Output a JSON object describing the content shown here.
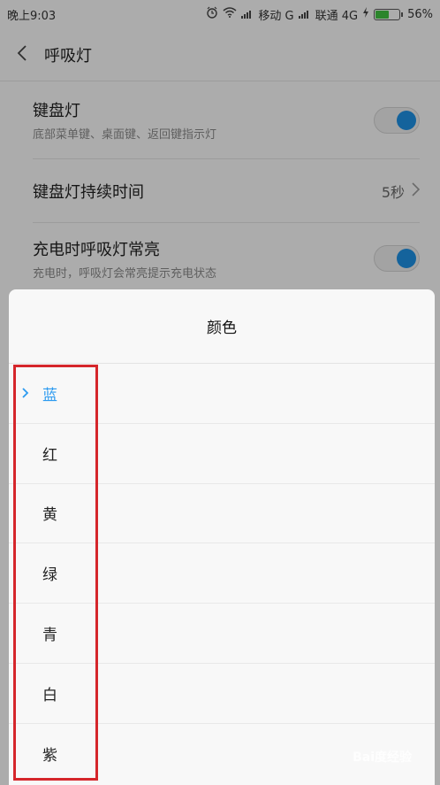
{
  "status_bar": {
    "time": "晚上9:03",
    "carrier1": "移动 G",
    "carrier2": "联通 4G",
    "battery": "56%",
    "battery_level": 0.56
  },
  "header": {
    "title": "呼吸灯"
  },
  "settings": [
    {
      "title": "键盘灯",
      "subtitle": "底部菜单键、桌面键、返回键指示灯",
      "type": "toggle",
      "on": true
    },
    {
      "title": "键盘灯持续时间",
      "value": "5秒",
      "type": "link"
    },
    {
      "title": "充电时呼吸灯常亮",
      "subtitle": "充电时，呼吸灯会常亮提示充电状态",
      "type": "toggle",
      "on": true
    }
  ],
  "sheet": {
    "title": "颜色",
    "options": [
      {
        "label": "蓝",
        "selected": true
      },
      {
        "label": "红",
        "selected": false
      },
      {
        "label": "黄",
        "selected": false
      },
      {
        "label": "绿",
        "selected": false
      },
      {
        "label": "青",
        "selected": false
      },
      {
        "label": "白",
        "selected": false
      },
      {
        "label": "紫",
        "selected": false
      }
    ]
  },
  "watermark": "Bai度经验",
  "colors": {
    "accent": "#2d9bf0",
    "toggle_on": "#1e8fe0",
    "highlight": "#d5262b"
  }
}
